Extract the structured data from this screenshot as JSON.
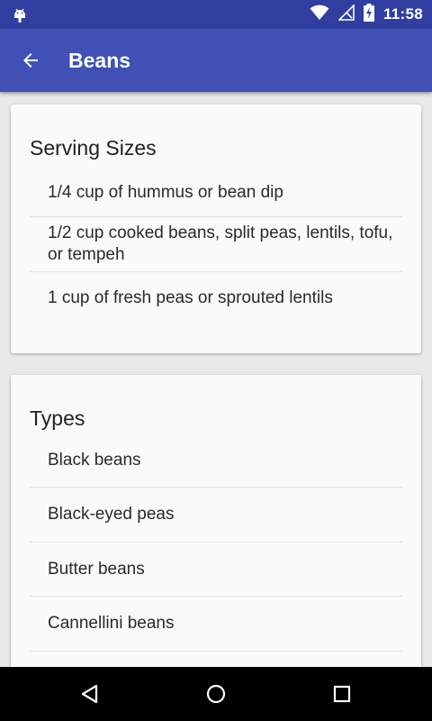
{
  "status_bar": {
    "time": "11:58",
    "icons": [
      "android-debug-icon",
      "wifi-icon",
      "no-signal-icon",
      "battery-charging-icon"
    ]
  },
  "app_bar": {
    "title": "Beans",
    "back_icon": "arrow-back-icon"
  },
  "cards": [
    {
      "title": "Serving Sizes",
      "items": [
        "1/4 cup of hummus or bean dip",
        "1/2 cup cooked beans, split peas, lentils, tofu, or tempeh",
        "1 cup of fresh peas or sprouted lentils"
      ]
    },
    {
      "title": "Types",
      "items": [
        "Black beans",
        "Black-eyed peas",
        "Butter beans",
        "Cannellini beans"
      ]
    }
  ],
  "nav_bar": {
    "icons": [
      "back-triangle-icon",
      "home-circle-icon",
      "recents-square-icon"
    ]
  },
  "colors": {
    "status_bar": "#303f9f",
    "app_bar": "#3f51b5",
    "card_bg": "#fafafa",
    "page_bg": "#e9e9e9"
  }
}
